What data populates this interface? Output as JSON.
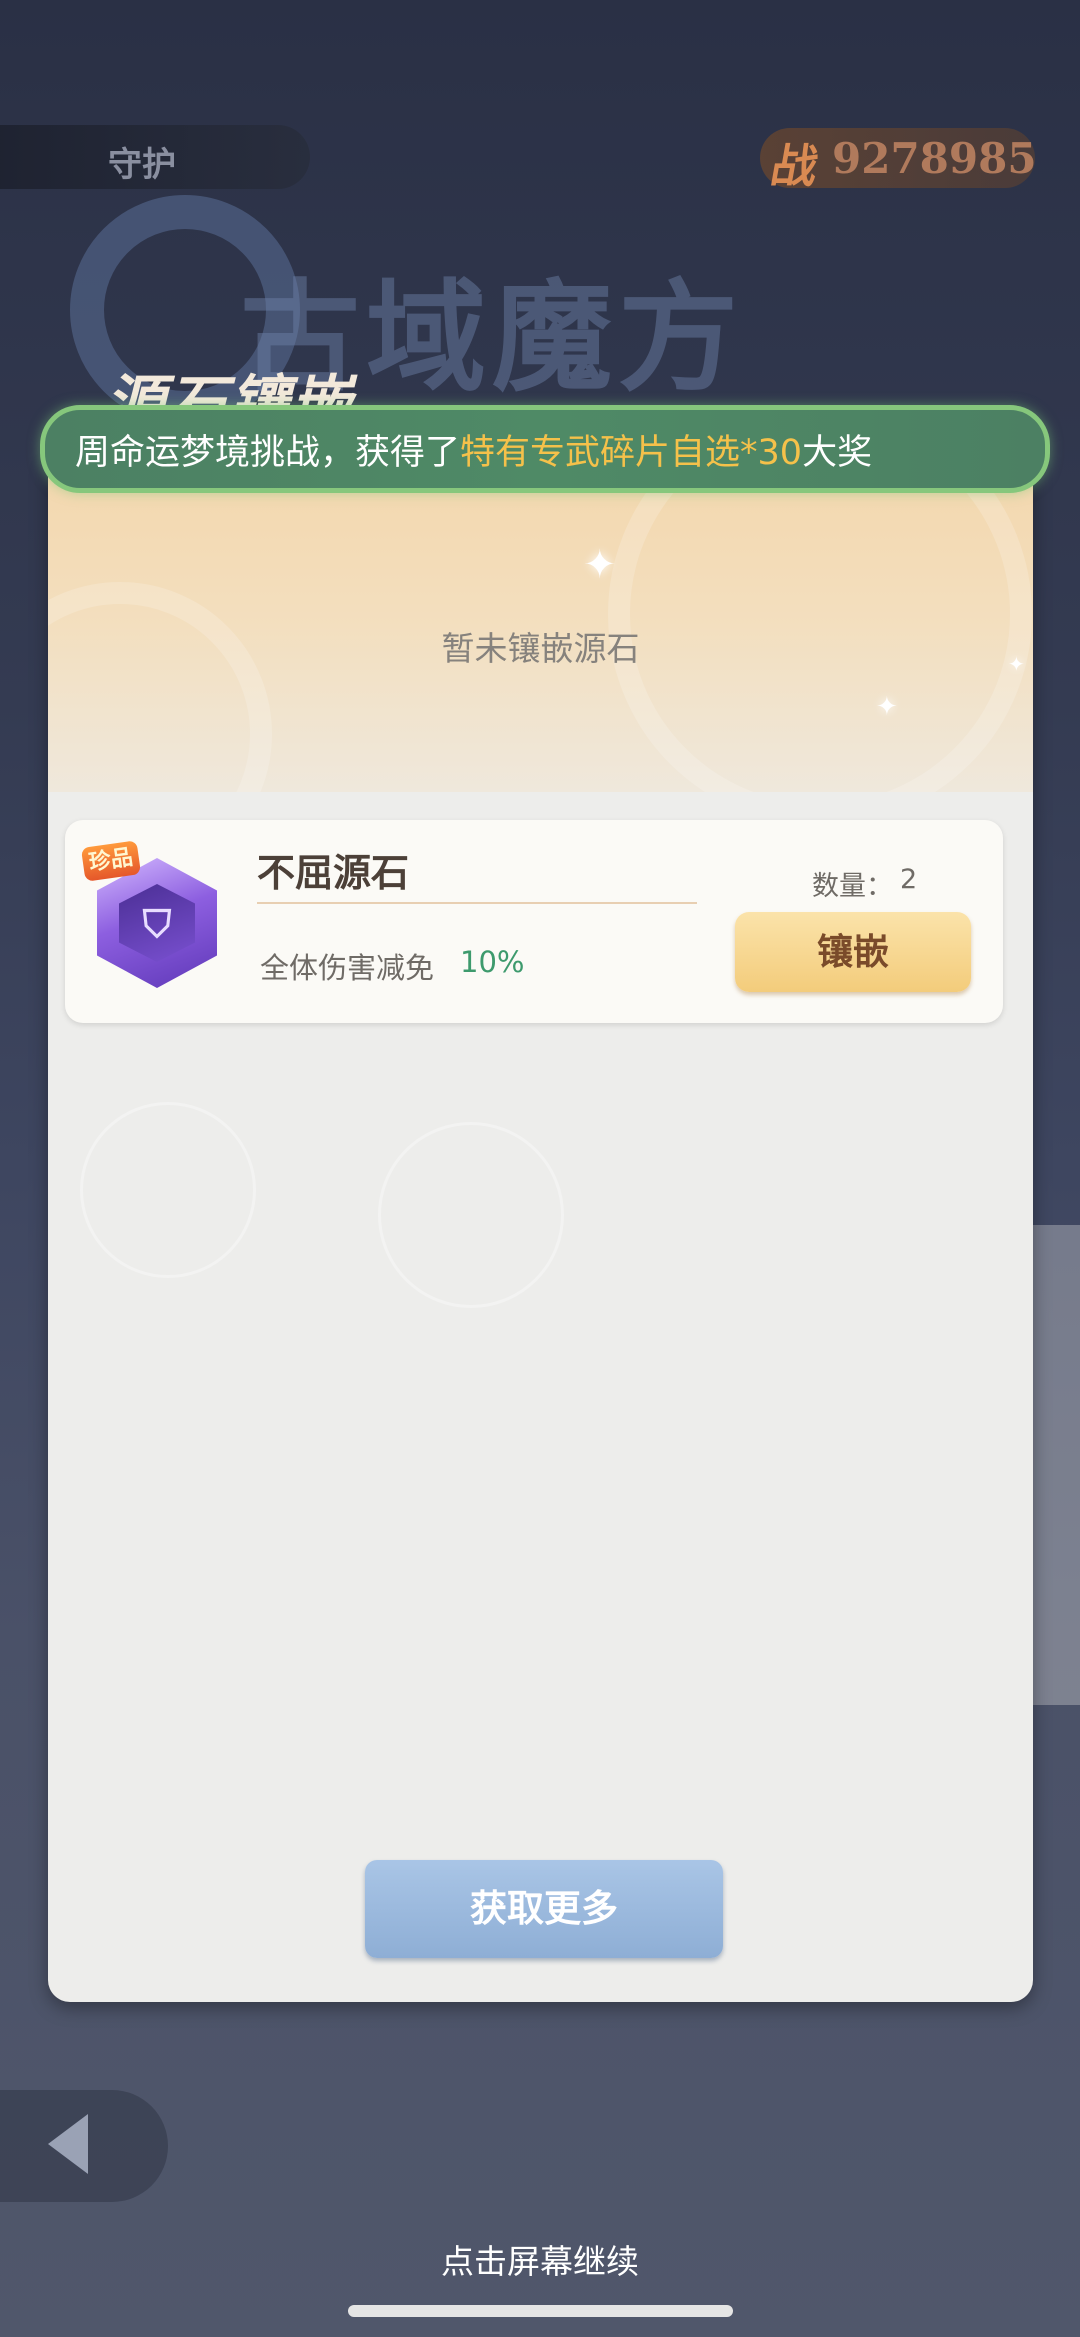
{
  "header": {
    "left_tab_label": "守护",
    "power_icon_label": "战",
    "power_value": "9278985"
  },
  "background": {
    "logo_text": "古域魔方",
    "section_title": "源石镶嵌"
  },
  "banner": {
    "text_prefix": "周命运梦境挑战，获得了",
    "text_highlight": "特有专武碎片自选*30",
    "text_suffix": "大奖"
  },
  "panel": {
    "empty_text": "暂未镶嵌源石",
    "item": {
      "rarity_badge": "珍品",
      "name": "不屈源石",
      "effect_label": "全体伤害减免",
      "effect_value": "10%",
      "quantity_label": "数量：",
      "quantity_value": "2",
      "inlay_button": "镶嵌"
    },
    "get_more_button": "获取更多"
  },
  "footer": {
    "continue_text": "点击屏幕继续"
  },
  "colors": {
    "banner_bg": "#4f8a66",
    "banner_highlight": "#f5c14a",
    "effect_value": "#3d9a6d",
    "inlay_button": "#f3cc7b",
    "get_more_button": "#8eaed5"
  }
}
